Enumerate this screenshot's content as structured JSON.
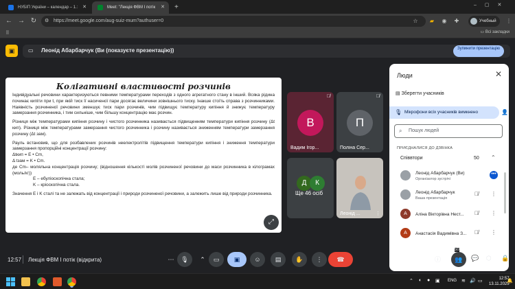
{
  "browser": {
    "tabs": [
      {
        "label": "НУБІП України – календар – 1.:",
        "favicon_color": "#1a73e8"
      },
      {
        "label": "Meet: \"Лекція ФВМ І потік",
        "favicon_color": "#00832d"
      }
    ],
    "new_tab": "+",
    "url": "https://meet.google.com/aug-suiz-mum?authuser=0",
    "profile_label": "Учебный",
    "all_bookmarks": "Всі закладки"
  },
  "meet": {
    "presenting_label": "Леонід Абарбарчук (Ви (показуєте презентацію))",
    "stop_button": "Зупинити презентацію",
    "slide": {
      "title": "Колігативні властивості розчинів",
      "paragraphs": [
        "Індивідуальні речовини характеризуються певними температурами переходів з одного агрегатного стану в інший. Всяка рідина починає кипіти при t, при якій тиск її насиченої пари досягає величини зовнішнього тиску. Інакше стоїть справа з розчинниками. Наявність розчиненої речовини зменшує тиск пари розчинів, чим підвищує температуру кипіння й знижує температуру замерзання розчинника, і тим сильніше, чим більшу концентрацію має розчин.",
        "Різниця між температурами кипіння розчину і чистого розчинника називається   підвищенням температури кипіння розчину (Δt кип). Різниця між температурами замерзання чистого розчинника і розчину називається зниженням температури замерзання розчину (Δt зам).",
        "Рауль встановив, що для розбавлених розчинів неелектролітів підвищення температури кипіння і зниження температури замерзання пропорційні концентрації розчину:",
        "Δtкип = E • Cm,",
        "Δ tзам = K • Cm.",
        "де Cm– моляльна концентрація розчину; (відношення кількості молів розчиненої речовини до маси розчинника в кілограмах (моль/кг))",
        "E – ебуліоскопічна стала;",
        "K – кріоскопічна стала.",
        "Значення E і K сталі та не залежать від концентрації і природи розчиненої речовини, а залежить лише від природи розчинника."
      ]
    },
    "tiles": [
      {
        "name": "Вадим Ігор...",
        "initial": "В",
        "color": "#c2185b"
      },
      {
        "name": "Поліна Сер...",
        "initial": "П",
        "color": "#5f6368"
      },
      {
        "name": "Ще 46 осіб",
        "initials": [
          "Д",
          "К"
        ]
      },
      {
        "name": "Леонід ..."
      }
    ],
    "bottom": {
      "time": "12:57",
      "meeting": "Лекція ФВМ І потік (відкрита)",
      "people_count": "50"
    }
  },
  "panel": {
    "title": "Люди",
    "save_participants": "Зберегти учасників",
    "mics_muted": "Мікрофони всіх учасників вимкнено",
    "search_placeholder": "Пошук людей",
    "joined_header": "ПРИЄДНАЛИСЯ ДО ДЗВІНКА",
    "group": {
      "label": "Співвтори",
      "count": "50"
    },
    "participants": [
      {
        "name": "Леонід Абарбарчук (Ви)",
        "role": "Організатор зустрічі",
        "avatar": "photo"
      },
      {
        "name": "Леонід Абарбарчук",
        "role": "Ваша презентація",
        "avatar": "photo"
      },
      {
        "name": "Аліна Вікторівна Нест...",
        "role": "",
        "initial": "А",
        "color": "#8d3a2b"
      },
      {
        "name": "Анастасія Вадимівна З...",
        "role": "",
        "initial": "А",
        "color": "#b23c17"
      }
    ]
  },
  "taskbar": {
    "lang": "ENG",
    "time": "12:57",
    "date": "13.11.2025"
  }
}
